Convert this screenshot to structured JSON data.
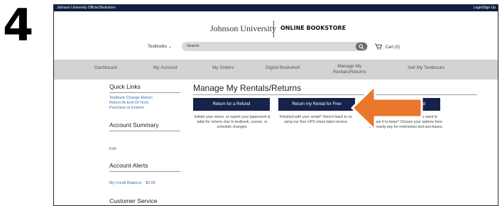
{
  "step_number": "4",
  "topbar": {
    "brand": "Johnson University Official Bookstore",
    "login": "Login/Sign Up"
  },
  "logo": {
    "university": "Johnson University",
    "store": "ONLINE BOOKSTORE"
  },
  "header": {
    "textbooks_dropdown": "Textbooks",
    "search_placeholder": "Search",
    "cart_label": "Cart (0)"
  },
  "nav": {
    "items": [
      "Dashboard",
      "My Account",
      "My Orders",
      "Digital Bookshelf",
      "Manage My",
      "Rentals/Returns",
      "Sell My Textbooks"
    ]
  },
  "sidebar": {
    "quick_links_title": "Quick Links",
    "quick_links": [
      "Textbook Change Return",
      "Return At End Of Term",
      "Purchase or Extend"
    ],
    "account_summary_title": "Account Summary",
    "edit_link": "Edit",
    "account_alerts_title": "Account Alerts",
    "credit_label": "My Credit Balance:",
    "credit_value": "$0.00",
    "customer_service_title": "Customer Service"
  },
  "main": {
    "title": "Manage My Rentals/Returns",
    "buttons": [
      "Return for a Refund",
      "Return my Rental for Free",
      "or Extend"
    ],
    "descriptions": [
      "Initiate your return, or reprint your paperwork & label for returns due to textbook, course, or schedule changes.",
      "Finished with your rental? Send it back to us using our free UPS return label service.",
      "d extra time with your rental or want to rchase it to keep? Choose your options here and easily pay for extensions and purchases."
    ]
  },
  "colors": {
    "topbar": "#0f1f45",
    "button": "#17224a",
    "nav_bg": "#d3d3d3",
    "link": "#3a6ea5",
    "arrow": "#e8762b"
  },
  "icons": {
    "search": "magnifier-icon",
    "cart": "cart-icon",
    "dropdown": "chevron-down-icon",
    "callout": "arrow-left-icon"
  }
}
